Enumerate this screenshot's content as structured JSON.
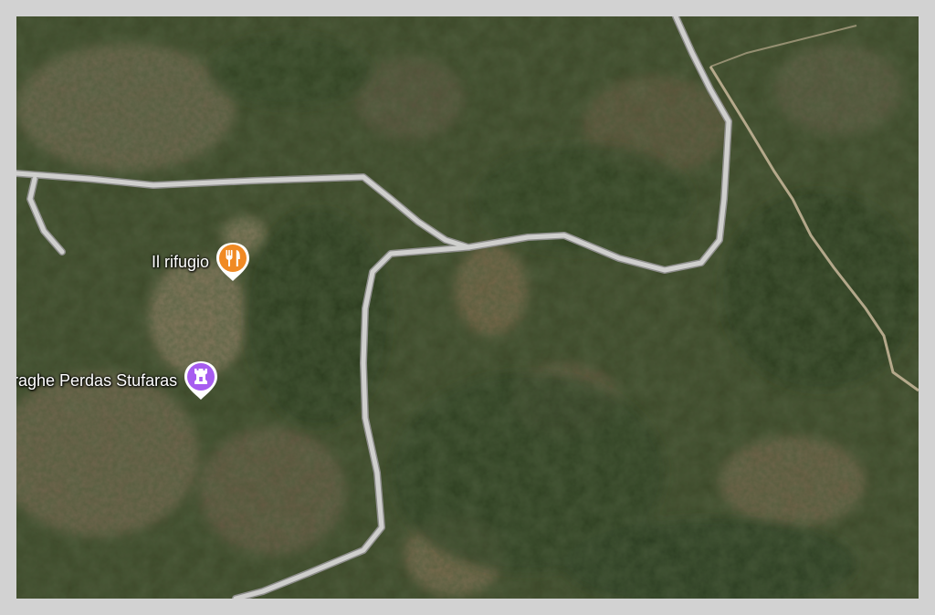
{
  "map": {
    "type": "satellite",
    "colors": {
      "road": "#c7c7c5",
      "road_edge": "#9a9a98",
      "trail": "#c9b89b",
      "restaurant_pin": "#f08a24",
      "landmark_pin": "#a75cf0"
    }
  },
  "pois": [
    {
      "label": "Il rifugio",
      "icon": "fork-knife-icon",
      "category": "restaurant"
    },
    {
      "label": "raghe Perdas Stufaras",
      "icon": "castle-tower-icon",
      "category": "historical-landmark"
    }
  ]
}
